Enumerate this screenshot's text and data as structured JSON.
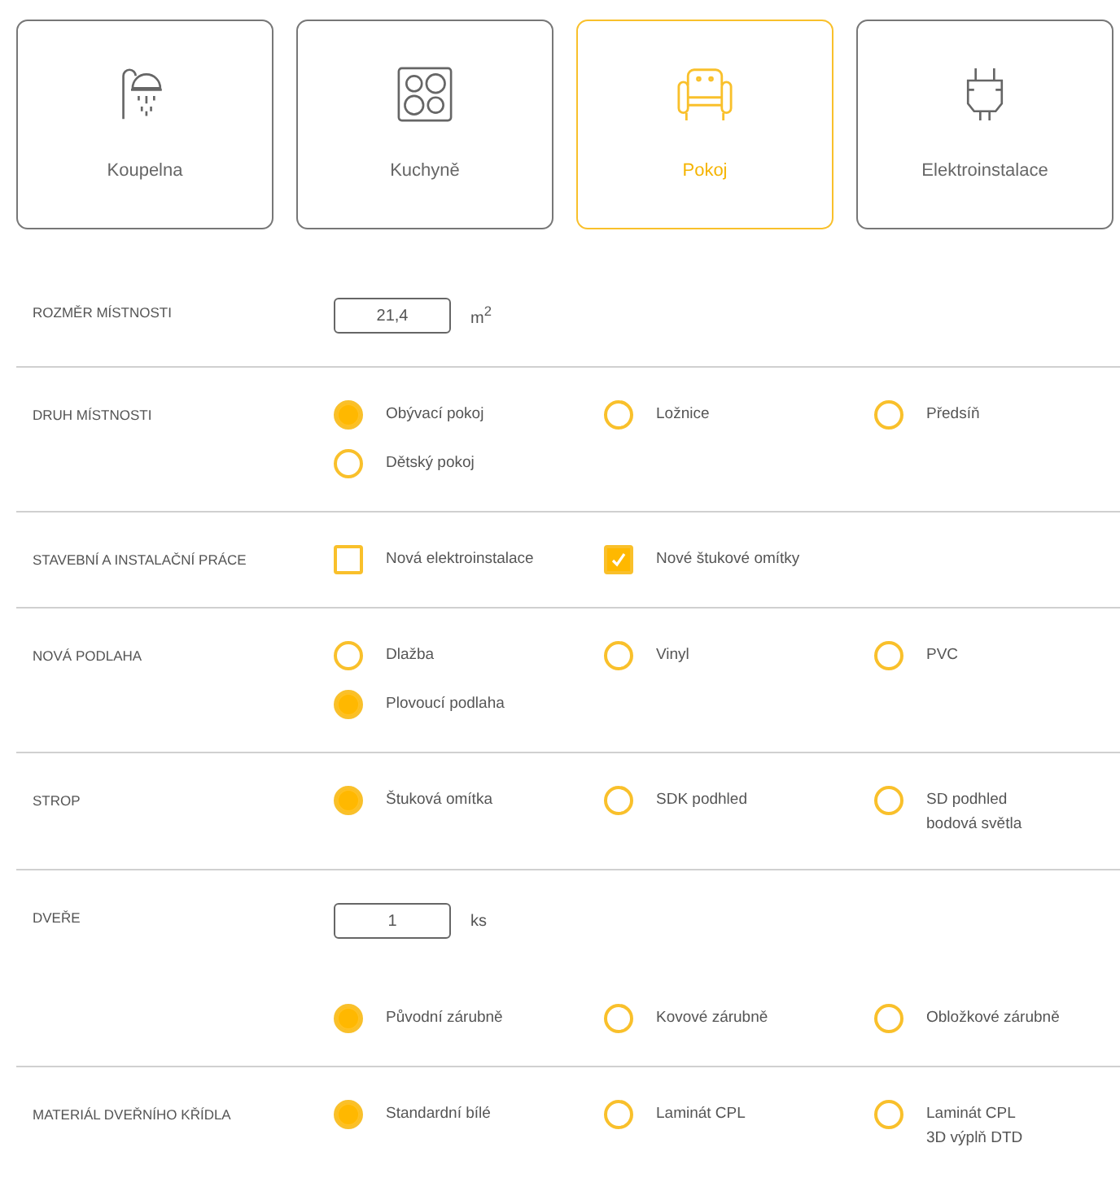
{
  "categories": [
    {
      "kind": "shower",
      "label": "Koupelna",
      "selected": false
    },
    {
      "kind": "cooktop",
      "label": "Kuchyně",
      "selected": false
    },
    {
      "kind": "armchair",
      "label": "Pokoj",
      "selected": true
    },
    {
      "kind": "plug",
      "label": "Elektroinstalace",
      "selected": false
    }
  ],
  "sections": [
    {
      "label": "ROZMĚR MÍSTNOSTI",
      "input": {
        "value": "21,4",
        "unit": "m$^{2}$"
      }
    },
    {
      "label": "DRUH MÍSTNOSTI",
      "options": [
        {
          "kind": "radio",
          "label": "Obývací pokoj",
          "selected": true
        },
        {
          "kind": "radio",
          "label": "Ložnice",
          "selected": false
        },
        {
          "kind": "radio",
          "label": "Předsíň",
          "selected": false
        },
        {
          "kind": "radio",
          "label": "Dětský pokoj",
          "selected": false
        }
      ]
    },
    {
      "label": "STAVEBNÍ A INSTALAČNÍ PRÁCE",
      "options": [
        {
          "kind": "checkbox",
          "label": "Nová elektroinstalace",
          "checked": false
        },
        {
          "kind": "checkbox",
          "label": "Nové štukové omítky",
          "checked": true
        }
      ]
    },
    {
      "label": "NOVÁ PODLAHA",
      "options": [
        {
          "kind": "radio",
          "label": "Dlažba",
          "selected": false
        },
        {
          "kind": "radio",
          "label": "Vinyl",
          "selected": false
        },
        {
          "kind": "radio",
          "label": "PVC",
          "selected": false
        },
        {
          "kind": "radio",
          "label": "Plovoucí podlaha",
          "selected": true
        }
      ]
    },
    {
      "label": "STROP",
      "options": [
        {
          "kind": "radio",
          "label": "Štuková omítka",
          "selected": true
        },
        {
          "kind": "radio",
          "label": "SDK podhled",
          "selected": false
        },
        {
          "kind": "radio",
          "label": "SD podhled\nbodová světla",
          "selected": false
        }
      ]
    },
    {
      "label": "DVEŘE",
      "input": {
        "value": "1",
        "unit": "ks"
      },
      "options": [
        {
          "kind": "radio",
          "label": "Původní zárubně",
          "selected": true
        },
        {
          "kind": "radio",
          "label": "Kovové zárubně",
          "selected": false
        },
        {
          "kind": "radio",
          "label": "Obložkové zárubně",
          "selected": false
        }
      ]
    },
    {
      "label": "MATERIÁL DVEŘNÍHO KŘÍDLA",
      "options": [
        {
          "kind": "radio",
          "label": "Standardní bílé",
          "selected": true
        },
        {
          "kind": "radio",
          "label": "Laminát CPL",
          "selected": false
        },
        {
          "kind": "radio",
          "label": "Laminát CPL\n3D výplň DTD",
          "selected": false
        }
      ]
    }
  ]
}
